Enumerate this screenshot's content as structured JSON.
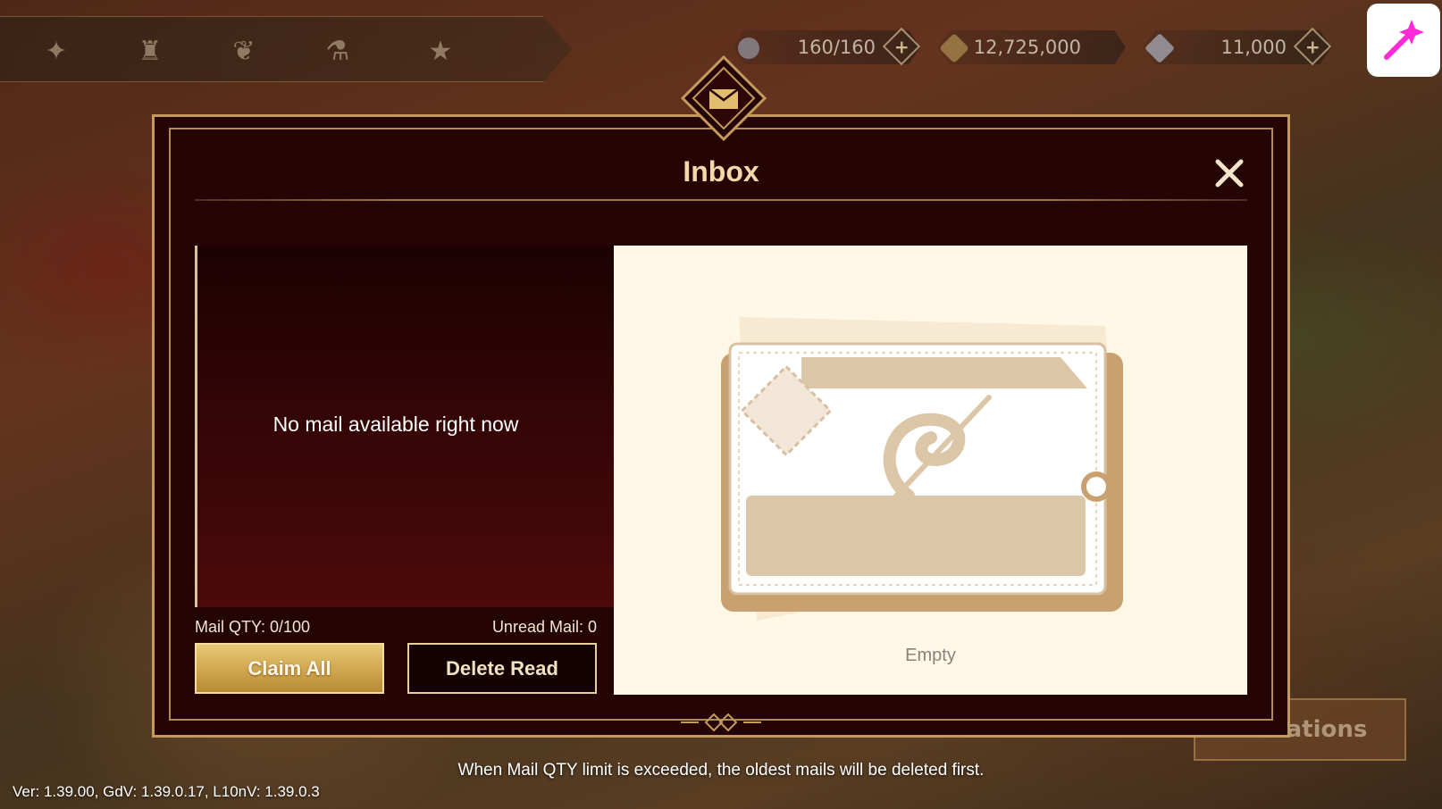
{
  "top_bar": {
    "stamina": {
      "icon": "moon-orb-icon",
      "value": "160/160"
    },
    "gold": {
      "icon": "gold-coin-icon",
      "value": "12,725,000"
    },
    "gems": {
      "icon": "crystal-gem-icon",
      "value": "11,000"
    },
    "plus_symbol": "+"
  },
  "background": {
    "partial_button_label": "ations"
  },
  "inbox": {
    "title": "Inbox",
    "close_symbol": "✕",
    "empty_message": "No mail available right now",
    "mail_qty": "Mail QTY: 0/100",
    "unread_mail": "Unread Mail: 0",
    "claim_all_label": "Claim All",
    "delete_read_label": "Delete Read",
    "detail_empty_label": "Empty"
  },
  "footer": {
    "note": "When Mail QTY limit is exceeded, the oldest mails will be deleted first.",
    "version": "Ver: 1.39.00, GdV: 1.39.0.17, L10nV: 1.39.0.3"
  },
  "colors": {
    "gold_accent": "#c39a5c",
    "dialog_bg": "#240405",
    "detail_bg": "#fff8e6",
    "tool_button_accent": "#ff2bd6"
  }
}
